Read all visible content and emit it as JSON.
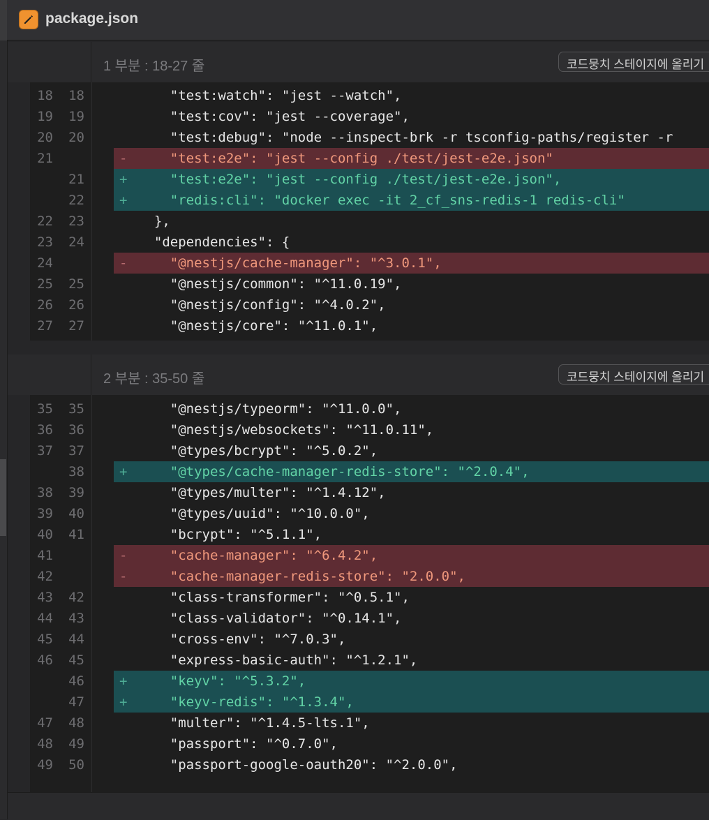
{
  "file": {
    "name": "package.json",
    "icon": "pencil-icon",
    "icon_color": "#f0922f"
  },
  "hunks": [
    {
      "label": "1 부분 : 18-27 줄",
      "stage_label": "코드뭉치 스테이지에 올리기",
      "lines": [
        {
          "old": "18",
          "new": "18",
          "type": "ctx",
          "mark": "",
          "text": "    \"test:watch\": \"jest --watch\","
        },
        {
          "old": "19",
          "new": "19",
          "type": "ctx",
          "mark": "",
          "text": "    \"test:cov\": \"jest --coverage\","
        },
        {
          "old": "20",
          "new": "20",
          "type": "ctx",
          "mark": "",
          "text": "    \"test:debug\": \"node --inspect-brk -r tsconfig-paths/register -r"
        },
        {
          "old": "21",
          "new": "",
          "type": "del",
          "mark": "-",
          "text": "    \"test:e2e\": \"jest --config ./test/jest-e2e.json\""
        },
        {
          "old": "",
          "new": "21",
          "type": "add",
          "mark": "+",
          "text": "    \"test:e2e\": \"jest --config ./test/jest-e2e.json\","
        },
        {
          "old": "",
          "new": "22",
          "type": "add",
          "mark": "+",
          "text": "    \"redis:cli\": \"docker exec -it 2_cf_sns-redis-1 redis-cli\""
        },
        {
          "old": "22",
          "new": "23",
          "type": "ctx",
          "mark": "",
          "text": "  },"
        },
        {
          "old": "23",
          "new": "24",
          "type": "ctx",
          "mark": "",
          "text": "  \"dependencies\": {"
        },
        {
          "old": "24",
          "new": "",
          "type": "del",
          "mark": "-",
          "text": "    \"@nestjs/cache-manager\": \"^3.0.1\","
        },
        {
          "old": "25",
          "new": "25",
          "type": "ctx",
          "mark": "",
          "text": "    \"@nestjs/common\": \"^11.0.19\","
        },
        {
          "old": "26",
          "new": "26",
          "type": "ctx",
          "mark": "",
          "text": "    \"@nestjs/config\": \"^4.0.2\","
        },
        {
          "old": "27",
          "new": "27",
          "type": "ctx",
          "mark": "",
          "text": "    \"@nestjs/core\": \"^11.0.1\","
        }
      ]
    },
    {
      "label": "2 부분 : 35-50 줄",
      "stage_label": "코드뭉치 스테이지에 올리기",
      "lines": [
        {
          "old": "35",
          "new": "35",
          "type": "ctx",
          "mark": "",
          "text": "    \"@nestjs/typeorm\": \"^11.0.0\","
        },
        {
          "old": "36",
          "new": "36",
          "type": "ctx",
          "mark": "",
          "text": "    \"@nestjs/websockets\": \"^11.0.11\","
        },
        {
          "old": "37",
          "new": "37",
          "type": "ctx",
          "mark": "",
          "text": "    \"@types/bcrypt\": \"^5.0.2\","
        },
        {
          "old": "",
          "new": "38",
          "type": "add",
          "mark": "+",
          "text": "    \"@types/cache-manager-redis-store\": \"^2.0.4\","
        },
        {
          "old": "38",
          "new": "39",
          "type": "ctx",
          "mark": "",
          "text": "    \"@types/multer\": \"^1.4.12\","
        },
        {
          "old": "39",
          "new": "40",
          "type": "ctx",
          "mark": "",
          "text": "    \"@types/uuid\": \"^10.0.0\","
        },
        {
          "old": "40",
          "new": "41",
          "type": "ctx",
          "mark": "",
          "text": "    \"bcrypt\": \"^5.1.1\","
        },
        {
          "old": "41",
          "new": "",
          "type": "del",
          "mark": "-",
          "text": "    \"cache-manager\": \"^6.4.2\","
        },
        {
          "old": "42",
          "new": "",
          "type": "del",
          "mark": "-",
          "text": "    \"cache-manager-redis-store\": \"2.0.0\","
        },
        {
          "old": "43",
          "new": "42",
          "type": "ctx",
          "mark": "",
          "text": "    \"class-transformer\": \"^0.5.1\","
        },
        {
          "old": "44",
          "new": "43",
          "type": "ctx",
          "mark": "",
          "text": "    \"class-validator\": \"^0.14.1\","
        },
        {
          "old": "45",
          "new": "44",
          "type": "ctx",
          "mark": "",
          "text": "    \"cross-env\": \"^7.0.3\","
        },
        {
          "old": "46",
          "new": "45",
          "type": "ctx",
          "mark": "",
          "text": "    \"express-basic-auth\": \"^1.2.1\","
        },
        {
          "old": "",
          "new": "46",
          "type": "add",
          "mark": "+",
          "text": "    \"keyv\": \"^5.3.2\","
        },
        {
          "old": "",
          "new": "47",
          "type": "add",
          "mark": "+",
          "text": "    \"keyv-redis\": \"^1.3.4\","
        },
        {
          "old": "47",
          "new": "48",
          "type": "ctx",
          "mark": "",
          "text": "    \"multer\": \"^1.4.5-lts.1\","
        },
        {
          "old": "48",
          "new": "49",
          "type": "ctx",
          "mark": "",
          "text": "    \"passport\": \"^0.7.0\","
        },
        {
          "old": "49",
          "new": "50",
          "type": "ctx",
          "mark": "",
          "text": "    \"passport-google-oauth20\": \"^2.0.0\","
        }
      ]
    }
  ],
  "colors": {
    "deleted_bg": "#5e2c33",
    "added_bg": "#1b4f52",
    "deleted_text": "#f0987c",
    "added_text": "#62d3a6"
  }
}
